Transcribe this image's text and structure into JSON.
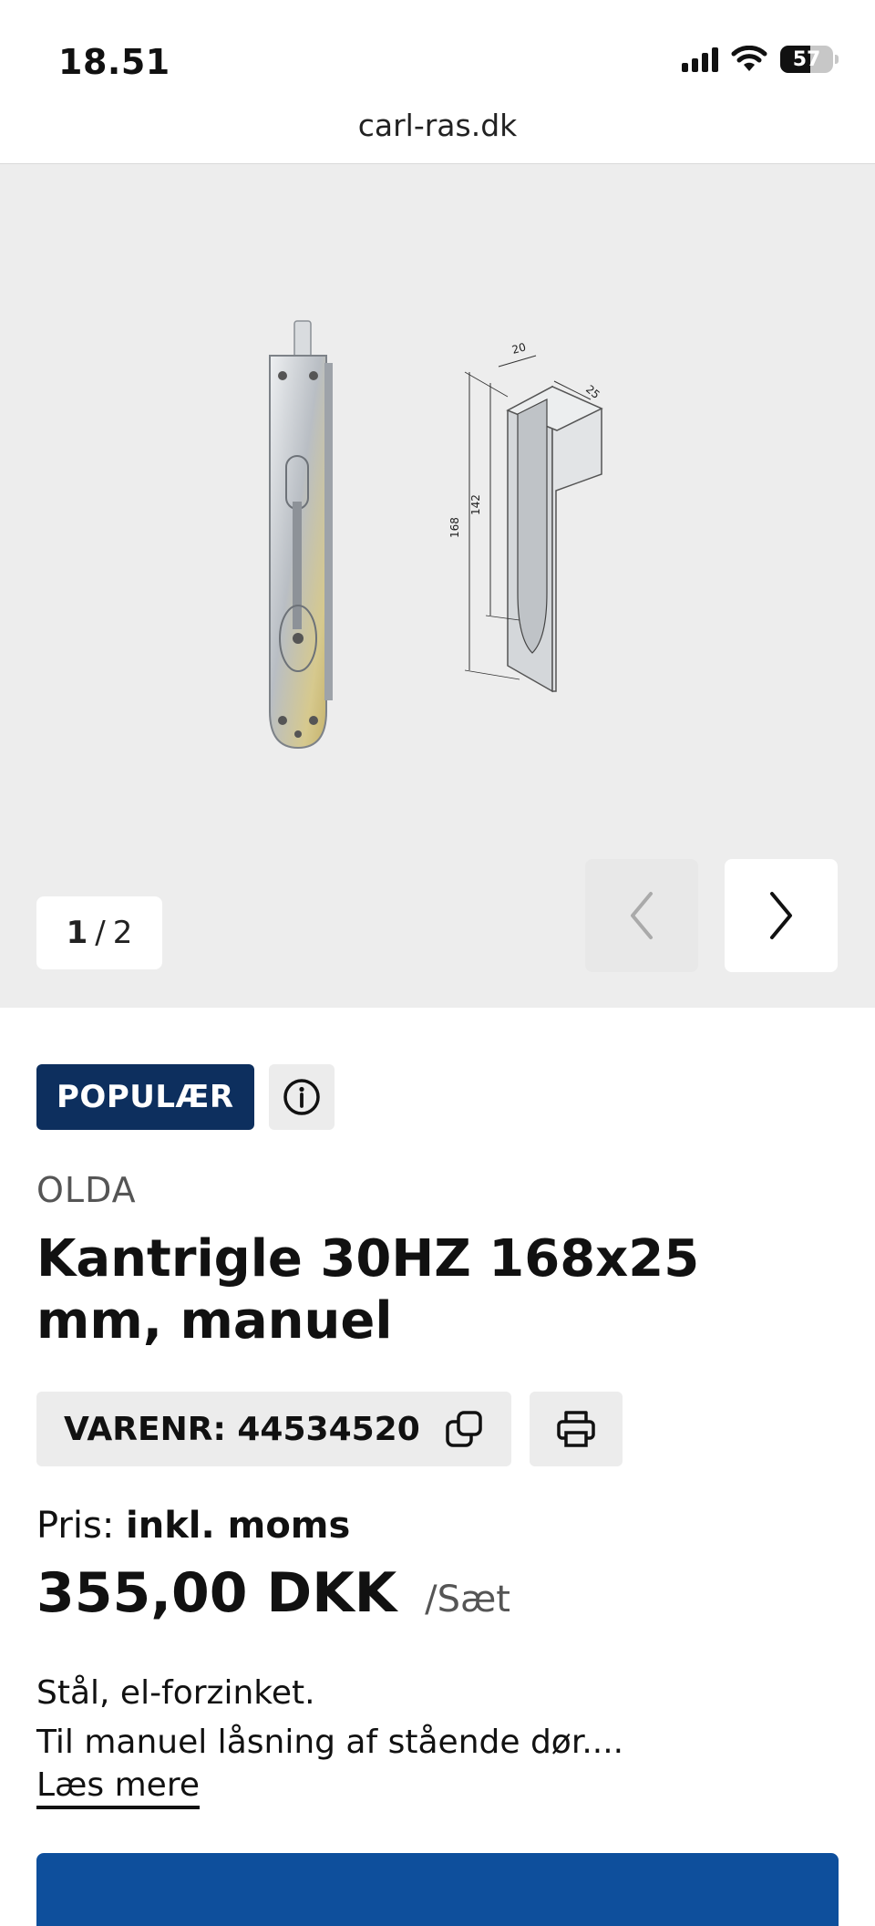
{
  "status_bar": {
    "time": "18.51",
    "battery": "57",
    "battery_level": 0.57
  },
  "browser": {
    "url": "carl-ras.dk"
  },
  "gallery": {
    "current": "1",
    "separator": "/",
    "total": "2",
    "image_labels": {
      "width": "20",
      "depth": "25",
      "height": "168",
      "inner": "142"
    }
  },
  "product": {
    "badge": "POPULÆR",
    "brand": "OLDA",
    "title": "Kantrigle 30HZ 168x25 mm, manuel",
    "sku": "VARENR: 44534520",
    "price_label": "Pris:",
    "price_vat": "inkl. moms",
    "price": "355,00 DKK",
    "price_unit": "/Sæt",
    "description_line1": "Stål, el-forzinket.",
    "description_line2": "Til manuel låsning af stående dør....",
    "read_more": "Læs mere"
  },
  "colors": {
    "accent": "#0d2f5e",
    "cta": "#0e4f9c",
    "gallery_bg": "#ededed"
  },
  "icons": {
    "info": "info-icon",
    "copy": "copy-icon",
    "print": "printer-icon",
    "prev": "chevron-left-icon",
    "next": "chevron-right-icon"
  }
}
